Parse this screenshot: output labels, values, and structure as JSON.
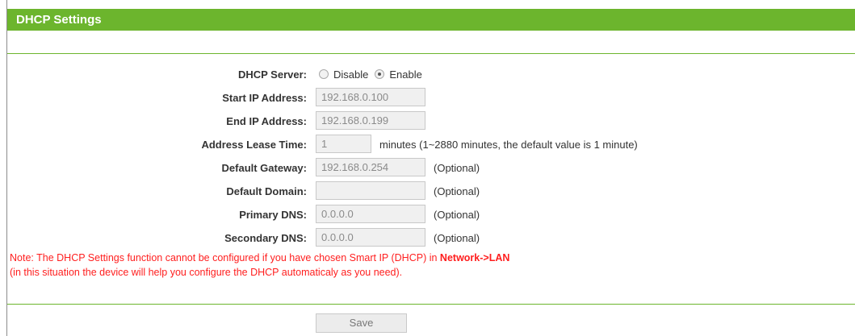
{
  "header": {
    "title": "DHCP Settings"
  },
  "dhcp_server": {
    "label": "DHCP Server:",
    "options": [
      {
        "label": "Disable",
        "selected": false
      },
      {
        "label": "Enable",
        "selected": true
      }
    ]
  },
  "fields": {
    "start_ip": {
      "label": "Start IP Address:",
      "value": "192.168.0.100"
    },
    "end_ip": {
      "label": "End IP Address:",
      "value": "192.168.0.199"
    },
    "lease_time": {
      "label": "Address Lease Time:",
      "value": "1",
      "hint": "minutes (1~2880 minutes, the default value is 1 minute)"
    },
    "gateway": {
      "label": "Default Gateway:",
      "value": "192.168.0.254",
      "suffix": "(Optional)"
    },
    "domain": {
      "label": "Default Domain:",
      "value": "",
      "suffix": "(Optional)"
    },
    "primary_dns": {
      "label": "Primary DNS:",
      "value": "0.0.0.0",
      "suffix": "(Optional)"
    },
    "secondary_dns": {
      "label": "Secondary DNS:",
      "value": "0.0.0.0",
      "suffix": "(Optional)"
    }
  },
  "note": {
    "line1_prefix": "Note: The DHCP Settings function cannot be configured if you have chosen Smart IP (DHCP) in ",
    "line1_link": "Network->LAN",
    "line2": "(in this situation the device will help you configure the DHCP automaticaly as you need)."
  },
  "save_label": "Save",
  "colors": {
    "header_bg": "#6cb52d",
    "note_text": "#ff1e1e"
  }
}
